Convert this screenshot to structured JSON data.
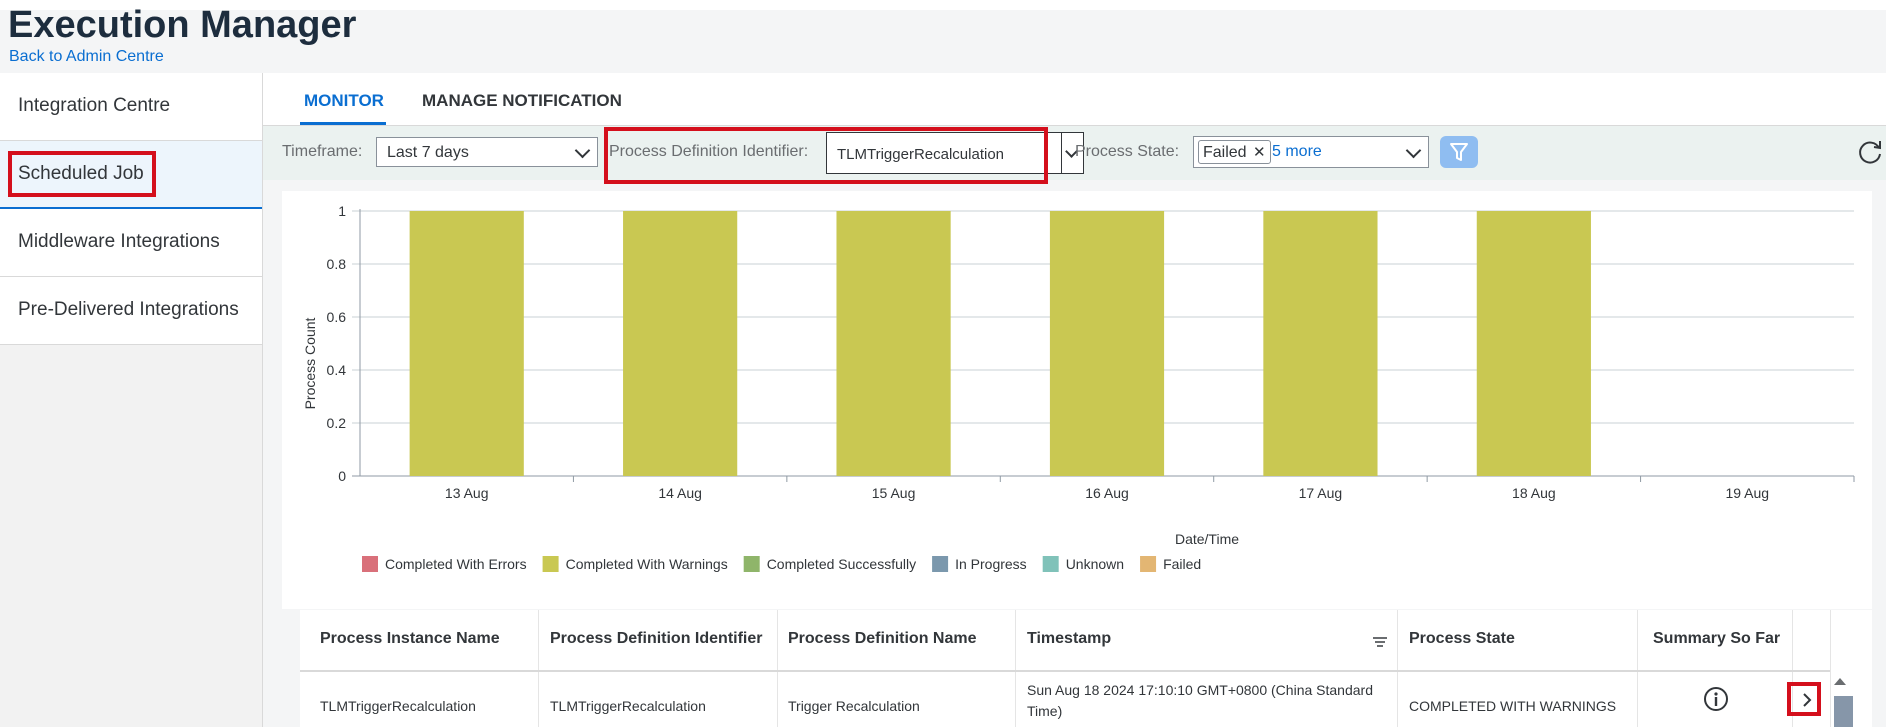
{
  "app": {
    "title": "Execution Manager",
    "back_link": "Back to Admin Centre"
  },
  "sidebar": {
    "items": [
      {
        "label": "Integration Centre"
      },
      {
        "label": "Scheduled Job"
      },
      {
        "label": "Middleware Integrations"
      },
      {
        "label": "Pre-Delivered Integrations"
      }
    ]
  },
  "tabs": [
    {
      "label": "MONITOR"
    },
    {
      "label": "MANAGE NOTIFICATION"
    }
  ],
  "filters": {
    "timeframe_label": "Timeframe:",
    "timeframe_value": "Last 7 days",
    "pdi_label": "Process Definition Identifier:",
    "pdi_value": "TLMTriggerRecalculation",
    "state_label": "Process State:",
    "state_token": "Failed",
    "state_more": "5 more"
  },
  "icons": {
    "filter": "filter-icon",
    "refresh": "refresh-icon",
    "info": "info-icon",
    "navigate": "chevron-right-icon"
  },
  "colors": {
    "accent": "#0a6ed1",
    "highlight": "#d40f1c"
  },
  "chart_data": {
    "type": "bar",
    "categories": [
      "13 Aug",
      "14 Aug",
      "15 Aug",
      "16 Aug",
      "17 Aug",
      "18 Aug",
      "19 Aug"
    ],
    "series": [
      {
        "name": "Completed With Errors",
        "color": "#d9707a",
        "values": [
          0,
          0,
          0,
          0,
          0,
          0,
          0
        ]
      },
      {
        "name": "Completed With Warnings",
        "color": "#c9c852",
        "values": [
          1,
          1,
          1,
          1,
          1,
          1,
          0
        ]
      },
      {
        "name": "Completed Successfully",
        "color": "#8fb56a",
        "values": [
          0,
          0,
          0,
          0,
          0,
          0,
          0
        ]
      },
      {
        "name": "In Progress",
        "color": "#7b98ad",
        "values": [
          0,
          0,
          0,
          0,
          0,
          0,
          0
        ]
      },
      {
        "name": "Unknown",
        "color": "#80c2b9",
        "values": [
          0,
          0,
          0,
          0,
          0,
          0,
          0
        ]
      },
      {
        "name": "Failed",
        "color": "#e3b673",
        "values": [
          0,
          0,
          0,
          0,
          0,
          0,
          0
        ]
      }
    ],
    "xlabel": "Date/Time",
    "ylabel": "Process Count",
    "ylim": [
      0,
      1
    ],
    "yticks": [
      "0",
      "0.2",
      "0.4",
      "0.6",
      "0.8",
      "1"
    ],
    "grid": true,
    "legend_position": "bottom-left"
  },
  "table": {
    "columns": [
      "Process Instance Name",
      "Process Definition Identifier",
      "Process Definition Name",
      "Timestamp",
      "Process State",
      "Summary So Far"
    ],
    "rows": [
      {
        "instance": "TLMTriggerRecalculation",
        "pdi": "TLMTriggerRecalculation",
        "pdn": "Trigger Recalculation",
        "timestamp_l1": "Sun Aug 18 2024 17:10:10 GMT+0800 (China Standard",
        "timestamp_l2": "Time)",
        "state": "COMPLETED WITH WARNINGS"
      }
    ]
  }
}
